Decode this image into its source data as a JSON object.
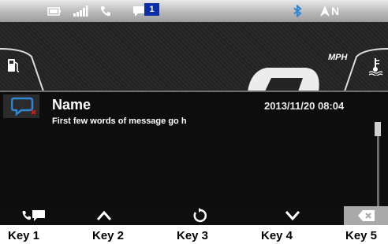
{
  "status_bar": {
    "notification_count": "1",
    "nav_indicator": "N",
    "icons": [
      "battery-icon",
      "signal-bars-icon",
      "phone-handset-icon",
      "message-notification-icon",
      "bluetooth-icon",
      "navigation-arrow-icon"
    ]
  },
  "dashboard": {
    "speed_unit": "MPH",
    "icons": [
      "fuel-pump-icon",
      "engine-temperature-icon"
    ]
  },
  "message": {
    "sender": "Name",
    "datetime": "2013/11/20 08:04",
    "preview": "First few words of message go h",
    "icon": "sms-unread-icon"
  },
  "softkeys": [
    {
      "label": "Key 1",
      "icon": "call-message-icon"
    },
    {
      "label": "Key 2",
      "icon": "chevron-up-icon"
    },
    {
      "label": "Key 3",
      "icon": "refresh-icon"
    },
    {
      "label": "Key 4",
      "icon": "chevron-down-icon"
    },
    {
      "label": "Key 5",
      "icon": "delete-icon"
    }
  ],
  "colors": {
    "accent_blue": "#2f86d6",
    "unread_red": "#d21b1b",
    "badge_blue": "#0a2fa8"
  }
}
